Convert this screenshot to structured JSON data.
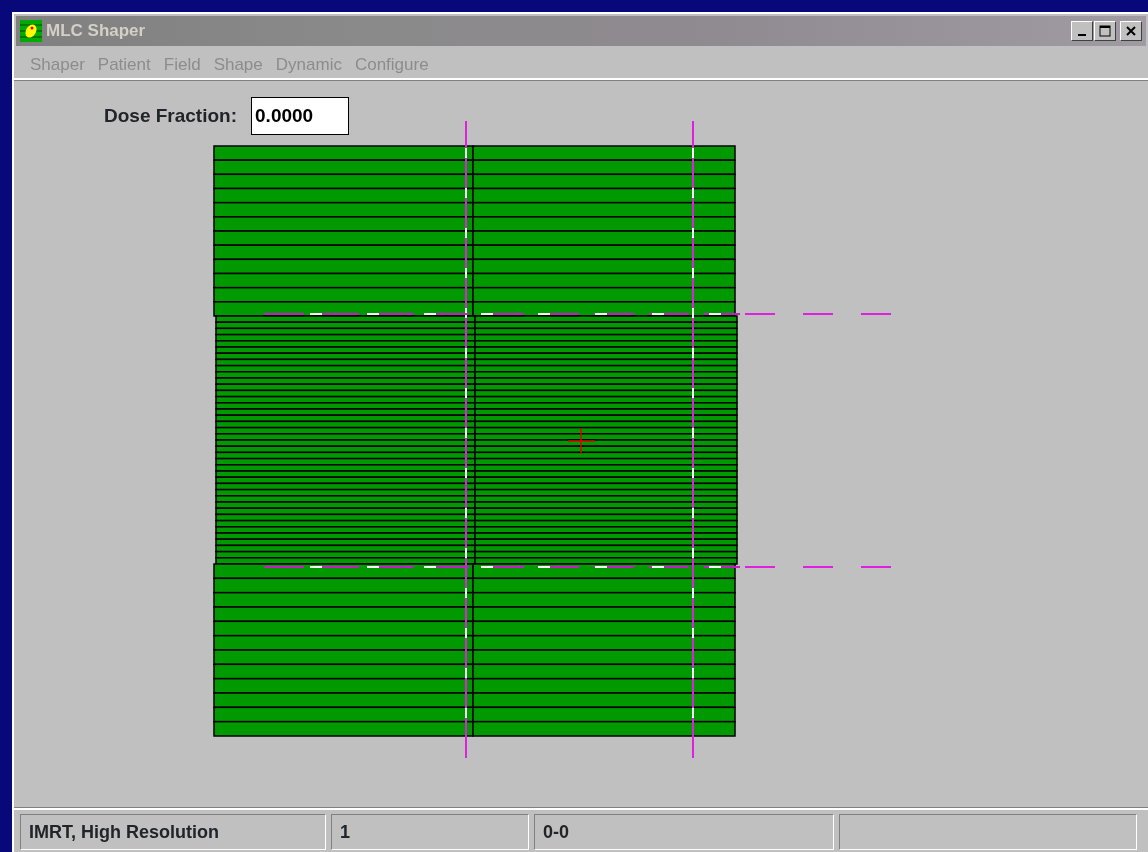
{
  "window": {
    "title": "MLC Shaper",
    "active": false
  },
  "menu": [
    {
      "label": "Shaper",
      "disabled": true
    },
    {
      "label": "Patient",
      "disabled": true
    },
    {
      "label": "Field",
      "disabled": true
    },
    {
      "label": "Shape",
      "disabled": true
    },
    {
      "label": "Dynamic",
      "disabled": true
    },
    {
      "label": "Configure",
      "disabled": true
    }
  ],
  "dose_fraction": {
    "label": "Dose Fraction:",
    "value": "0.0000"
  },
  "status_bar": [
    "IMRT, High Resolution",
    "1",
    "0-0"
  ]
}
